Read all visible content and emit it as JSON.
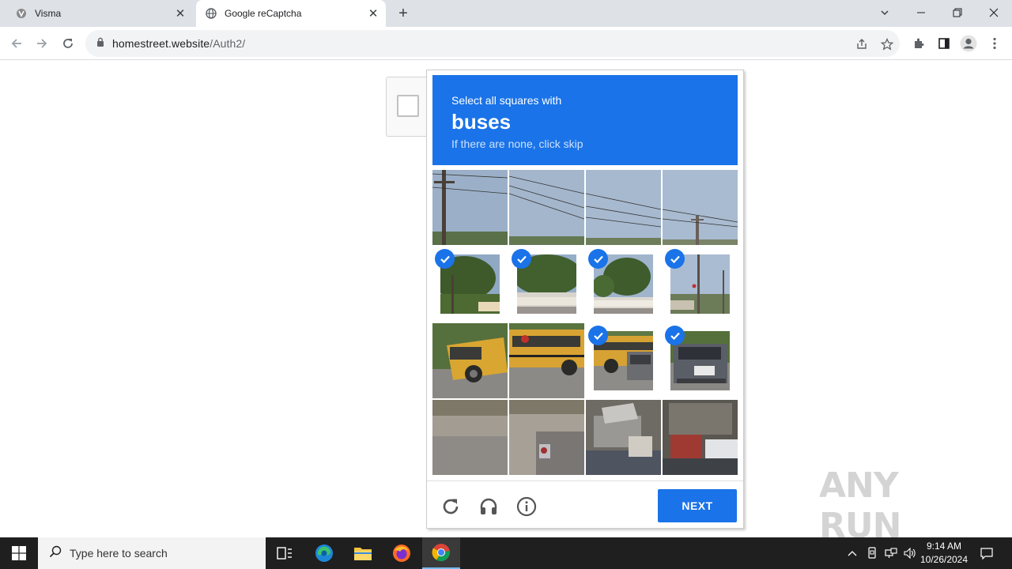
{
  "browser": {
    "tabs": [
      {
        "title": "Visma",
        "active": false
      },
      {
        "title": "Google reCaptcha",
        "active": true
      }
    ],
    "url_host": "homestreet.website",
    "url_path": "/Auth2/"
  },
  "captcha": {
    "instruction": "Select all squares with",
    "target": "buses",
    "hint": "If there are none, click skip",
    "selected_tiles": [
      4,
      5,
      6,
      7,
      10,
      11
    ],
    "button_label": "NEXT"
  },
  "watermark": "ANY RUN",
  "taskbar": {
    "search_placeholder": "Type here to search",
    "time": "9:14 AM",
    "date": "10/26/2024"
  },
  "colors": {
    "accent": "#1a73e8",
    "tabstrip": "#dee1e6",
    "taskbar": "#1f1f1f"
  }
}
